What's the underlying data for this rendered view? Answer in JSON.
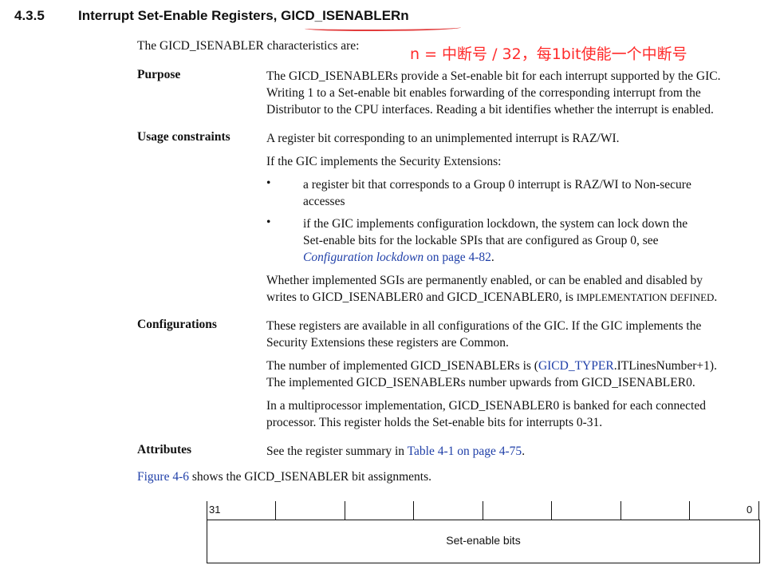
{
  "section": {
    "number": "4.3.5",
    "title_prefix": "Interrupt Set-Enable Registers, ",
    "title_register": "GICD_ISENABLERn"
  },
  "intro": "The GICD_ISENABLER characteristics are:",
  "annotation": "n = 中断号 / 32，每1bit使能一个中断号",
  "purpose": {
    "label": "Purpose",
    "lines": [
      "The GICD_ISENABLERs provide a Set-enable bit for each interrupt supported by the GIC.",
      "Writing 1 to a Set-enable bit enables forwarding of the corresponding interrupt from the",
      "Distributor to the CPU interfaces. Reading a bit identifies whether the interrupt is enabled."
    ]
  },
  "usage": {
    "label": "Usage constraints",
    "p1": "A register bit corresponding to an unimplemented interrupt is RAZ/WI.",
    "p2": "If the GIC implements the Security Extensions:",
    "bullet_char": "•",
    "b1_lines": [
      "a register bit that corresponds to a Group 0 interrupt is RAZ/WI to Non-secure",
      "accesses"
    ],
    "b2_lines": [
      "if the GIC implements configuration lockdown, the system can lock down the",
      "Set-enable bits for the lockable SPIs that are configured as Group 0, see"
    ],
    "b2_link": "Configuration lockdown",
    "b2_link_tail": "on page 4-82",
    "b2_end": ".",
    "p3_line1": "Whether implemented SGIs are permanently enabled, or can be enabled and disabled by",
    "p3_line2_a": "writes to GICD_ISENABLER0 and GICD_ICENABLER0, is ",
    "p3_line2_sc": "IMPLEMENTATION DEFINED",
    "p3_line2_end": "."
  },
  "configurations": {
    "label": "Configurations",
    "p1_lines": [
      "These registers are available in all configurations of the GIC. If the GIC implements the",
      "Security Extensions these registers are Common."
    ],
    "p2_a": "The number of implemented GICD_ISENABLERs is (",
    "p2_link": "GICD_TYPER",
    "p2_b": ".ITLinesNumber+1).",
    "p2_line2": "The implemented GICD_ISENABLERs number upwards from GICD_ISENABLER0.",
    "p3_lines": [
      "In a multiprocessor implementation, GICD_ISENABLER0 is banked for each connected",
      "processor. This register holds the Set-enable bits for interrupts 0-31."
    ]
  },
  "attributes": {
    "label": "Attributes",
    "text": "See the register summary in ",
    "link": "Table 4-1 on page 4-75",
    "end": "."
  },
  "figure_ref": {
    "link": "Figure 4-6",
    "text": " shows the GICD_ISENABLER bit assignments."
  },
  "register": {
    "high_bit": "31",
    "low_bit": "0",
    "field": "Set-enable bits"
  }
}
